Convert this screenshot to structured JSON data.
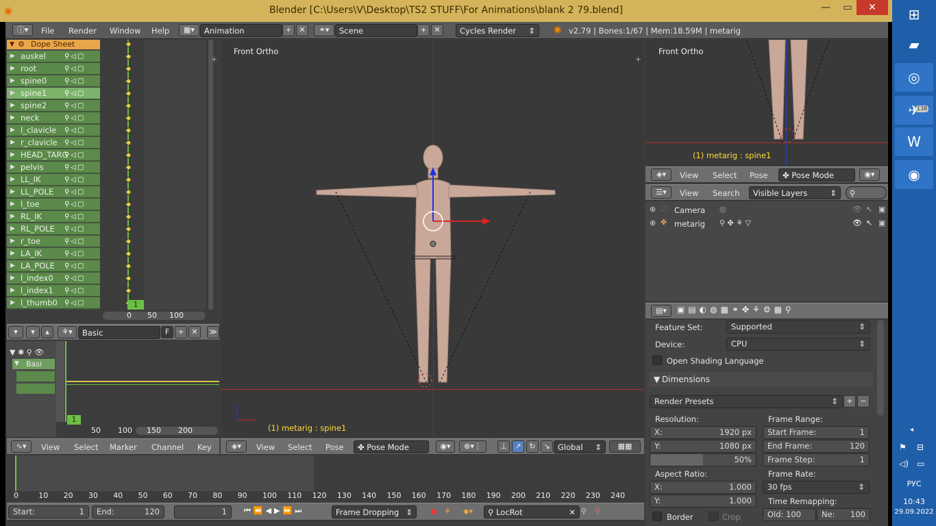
{
  "window": {
    "title": "Blender [C:\\Users\\V\\Desktop\\TS2 STUFF\\For Animations\\blank 2 79.blend]"
  },
  "topbar": {
    "menus": [
      "File",
      "Render",
      "Window",
      "Help"
    ],
    "layout": "Animation",
    "scene": "Scene",
    "engine": "Cycles Render",
    "stats": "v2.79 | Bones:1/67  | Mem:18.59M | metarig"
  },
  "dopesheet": {
    "summary_label": "Dope Sheet Summ",
    "channels": [
      "auskel",
      "root",
      "spine0",
      "spine1",
      "spine2",
      "neck",
      "l_clavicle",
      "r_clavicle",
      "HEAD_TARG",
      "pelvis",
      "LL_IK",
      "LL_POLE",
      "l_toe",
      "RL_IK",
      "RL_POLE",
      "r_toe",
      "LA_IK",
      "LA_POLE",
      "l_index0",
      "l_index1",
      "l_thumb0"
    ],
    "selected": "spine1",
    "current_frame": "1",
    "ruler": [
      "0",
      "50",
      "100"
    ]
  },
  "nla": {
    "keying_set": "Basic",
    "f_label": "F",
    "track_label": "Basi",
    "current_frame": "1",
    "ruler": [
      "50",
      "100",
      "150",
      "200"
    ]
  },
  "curve_header": {
    "menus": [
      "View",
      "Select",
      "Marker",
      "Channel",
      "Key"
    ]
  },
  "viewport": {
    "view_label": "Front Ortho",
    "object_label": "(1) metarig : spine1",
    "header_menus": [
      "View",
      "Select",
      "Pose"
    ],
    "mode": "Pose Mode",
    "orientation": "Global"
  },
  "viewport_small": {
    "view_label": "Front Ortho",
    "object_label": "(1) metarig : spine1",
    "header_menus": [
      "View",
      "Select",
      "Pose"
    ],
    "mode": "Pose Mode"
  },
  "outliner": {
    "menus": [
      "View",
      "Search"
    ],
    "filter": "Visible Layers",
    "items": [
      "Camera",
      "metarig"
    ]
  },
  "properties": {
    "feature_set_label": "Feature Set:",
    "feature_set": "Supported",
    "device_label": "Device:",
    "device": "CPU",
    "osl_label": "Open Shading Language",
    "dimensions_title": "Dimensions",
    "render_presets": "Render Presets",
    "resolution_label": "Resolution:",
    "res_x_label": "X:",
    "res_x": "1920 px",
    "res_y_label": "Y:",
    "res_y": "1080 px",
    "res_pct": "50%",
    "frame_range_label": "Frame Range:",
    "start_frame_label": "Start Frame:",
    "start_frame": "1",
    "end_frame_label": "End Frame:",
    "end_frame": "120",
    "frame_step_label": "Frame Step:",
    "frame_step": "1",
    "aspect_label": "Aspect Ratio:",
    "asp_x_label": "X:",
    "asp_x": "1.000",
    "asp_y_label": "Y:",
    "asp_y": "1.000",
    "frame_rate_label": "Frame Rate:",
    "frame_rate": "30 fps",
    "time_remap_label": "Time Remapping:",
    "old_label": "Old:",
    "old": "100",
    "new_label": "Ne:",
    "new": "100",
    "border_label": "Border",
    "crop_label": "Crop"
  },
  "timeline": {
    "ticks": [
      "0",
      "10",
      "20",
      "30",
      "40",
      "50",
      "60",
      "70",
      "80",
      "90",
      "100",
      "110",
      "120",
      "130",
      "140",
      "150",
      "160",
      "170",
      "180",
      "190",
      "200",
      "210",
      "220",
      "230",
      "240"
    ],
    "start_label": "Start:",
    "start": "1",
    "end_label": "End:",
    "end": "120",
    "current": "1",
    "sync": "Frame Dropping",
    "keyset": "LocRot"
  },
  "taskbar": {
    "lang": "РУС",
    "time": "10:43",
    "date": "29.09.2022",
    "telegram_badge": "138"
  },
  "colors": {
    "accent": "#e8a54a",
    "channel_green": "#5b8a4a",
    "taskbar": "#1f5fa9",
    "titlebar": "#d4b35a"
  }
}
